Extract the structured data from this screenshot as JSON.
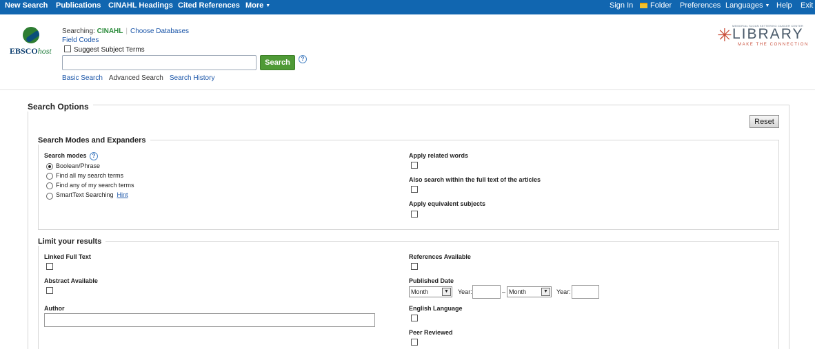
{
  "topnav": {
    "left": [
      "New Search",
      "Publications",
      "CINAHL Headings",
      "Cited References",
      "More"
    ],
    "right": {
      "sign_in": "Sign In",
      "folder": "Folder",
      "preferences": "Preferences",
      "languages": "Languages",
      "help": "Help",
      "exit": "Exit"
    }
  },
  "logo": {
    "ebsco": "EBSCO",
    "host": "host"
  },
  "library_logo": {
    "small": "MEMORIAL SLOAN KETTERING CANCER CENTER",
    "big": "LIBRARY",
    "tagline": "MAKE THE CONNECTION"
  },
  "search": {
    "searching_label": "Searching:",
    "database": "CINAHL",
    "choose_databases": "Choose Databases",
    "field_codes": "Field Codes",
    "suggest_subject_terms": "Suggest Subject Terms",
    "query": "",
    "button": "Search",
    "help": "?",
    "basic": "Basic Search",
    "advanced": "Advanced Search",
    "history": "Search History"
  },
  "options": {
    "title": "Search Options",
    "reset": "Reset",
    "modes_section": {
      "title": "Search Modes and Expanders",
      "search_modes_label": "Search modes",
      "help": "?",
      "modes": [
        "Boolean/Phrase",
        "Find all my search terms",
        "Find any of my search terms",
        "SmartText Searching"
      ],
      "selected_mode": "Boolean/Phrase",
      "hint": "Hint",
      "apply_related_words": "Apply related words",
      "full_text_search": "Also search within the full text of the articles",
      "equivalent_subjects": "Apply equivalent subjects"
    },
    "limits_section": {
      "title": "Limit your results",
      "linked_full_text": "Linked Full Text",
      "abstract_available": "Abstract Available",
      "author": "Author",
      "author_value": "",
      "references_available": "References Available",
      "published_date": "Published Date",
      "month_option": "Month",
      "year_label": "Year:",
      "dash": "–",
      "english_language": "English Language",
      "peer_reviewed": "Peer Reviewed"
    }
  }
}
